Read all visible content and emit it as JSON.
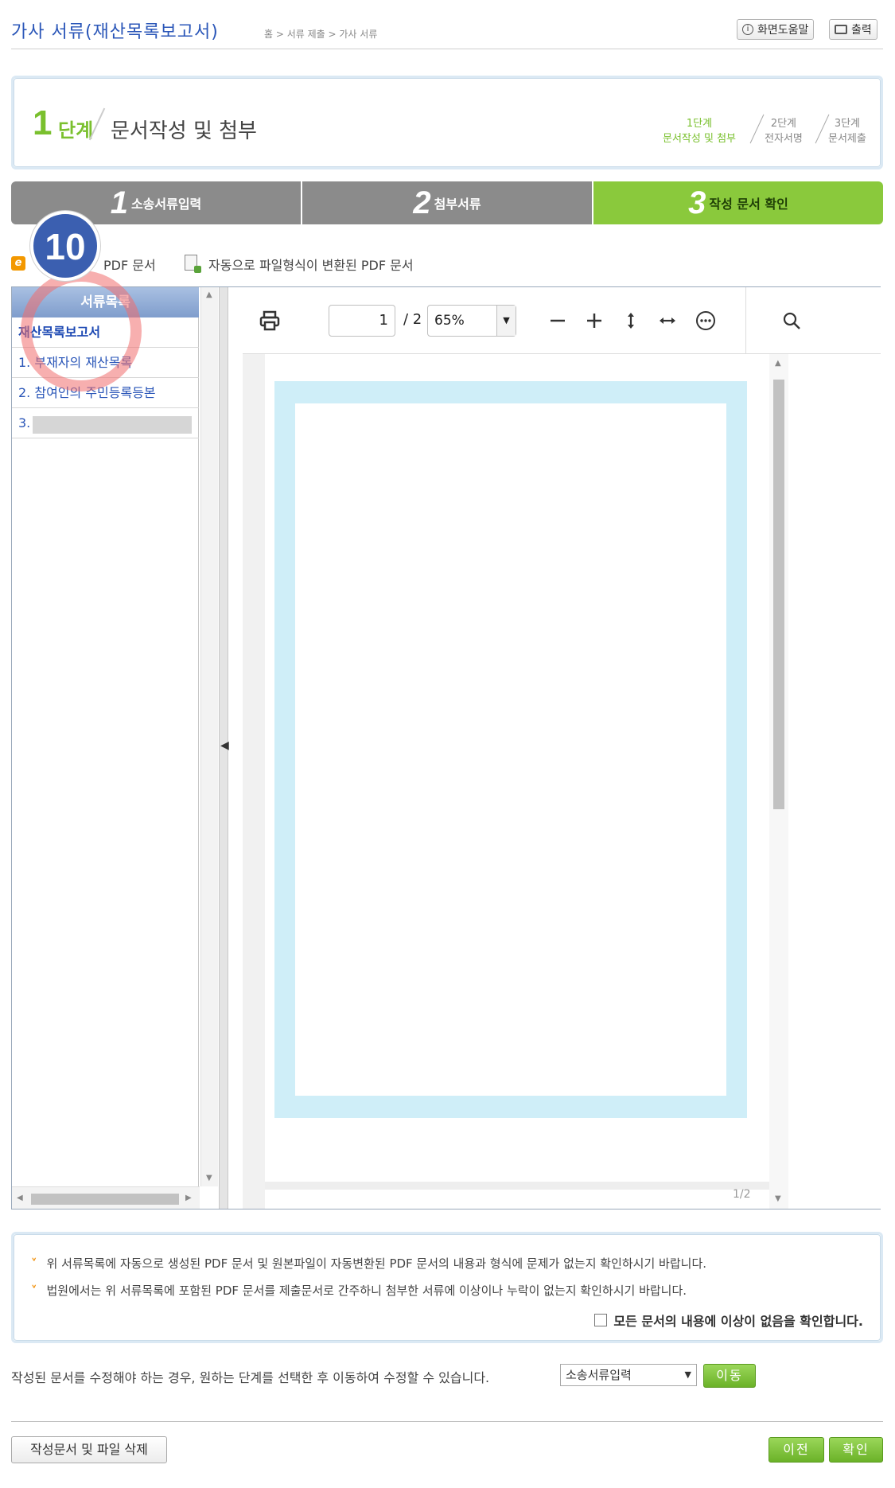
{
  "header": {
    "title": "가사 서류(재산목록보고서)",
    "breadcrumb": "홈 > 서류 제출 > 가사 서류",
    "help_button": "화면도움말",
    "print_button": "출력"
  },
  "stepbox": {
    "number": "1",
    "label": "단계",
    "name": "문서작성 및 첨부",
    "flow": [
      {
        "line1": "1단계",
        "line2": "문서작성 및 첨부"
      },
      {
        "line1": "2단계",
        "line2": "전자서명"
      },
      {
        "line1": "3단계",
        "line2": "문서제출"
      }
    ]
  },
  "tabs": [
    {
      "num": "1",
      "label": "소송서류입력"
    },
    {
      "num": "2",
      "label": "첨부서류"
    },
    {
      "num": "3",
      "label": "작성 문서 확인"
    }
  ],
  "legend": {
    "auto_pdf": "PDF 문서",
    "converted_pdf": "자동으로 파일형식이 변환된 PDF 문서"
  },
  "doclist": {
    "header": "서류목록",
    "items": [
      "재산목록보고서",
      "1. 부재자의 재산목록",
      "2. 참여인의 주민등록등본",
      "3."
    ]
  },
  "viewer": {
    "page_current": "1",
    "page_total": "/ 2",
    "zoom": "65%",
    "page_indicator": "1/2"
  },
  "marker": {
    "number": "10"
  },
  "notices": [
    "위 서류목록에 자동으로 생성된 PDF 문서 및 원본파일이 자동변환된 PDF 문서의 내용과 형식에 문제가 없는지 확인하시기 바랍니다.",
    "법원에서는 위 서류목록에 포함된 PDF 문서를 제출문서로 간주하니 첨부한 서류에 이상이나 누락이 없는지 확인하시기 바랍니다."
  ],
  "confirm_label": "모든 문서의 내용에 이상이 없음을 확인합니다.",
  "move": {
    "text": "작성된 문서를 수정해야 하는 경우, 원하는 단계를 선택한 후 이동하여 수정할 수 있습니다.",
    "selected": "소송서류입력",
    "button": "이동"
  },
  "footer": {
    "delete_button": "작성문서 및 파일 삭제",
    "prev_button": "이전",
    "ok_button": "확인"
  }
}
